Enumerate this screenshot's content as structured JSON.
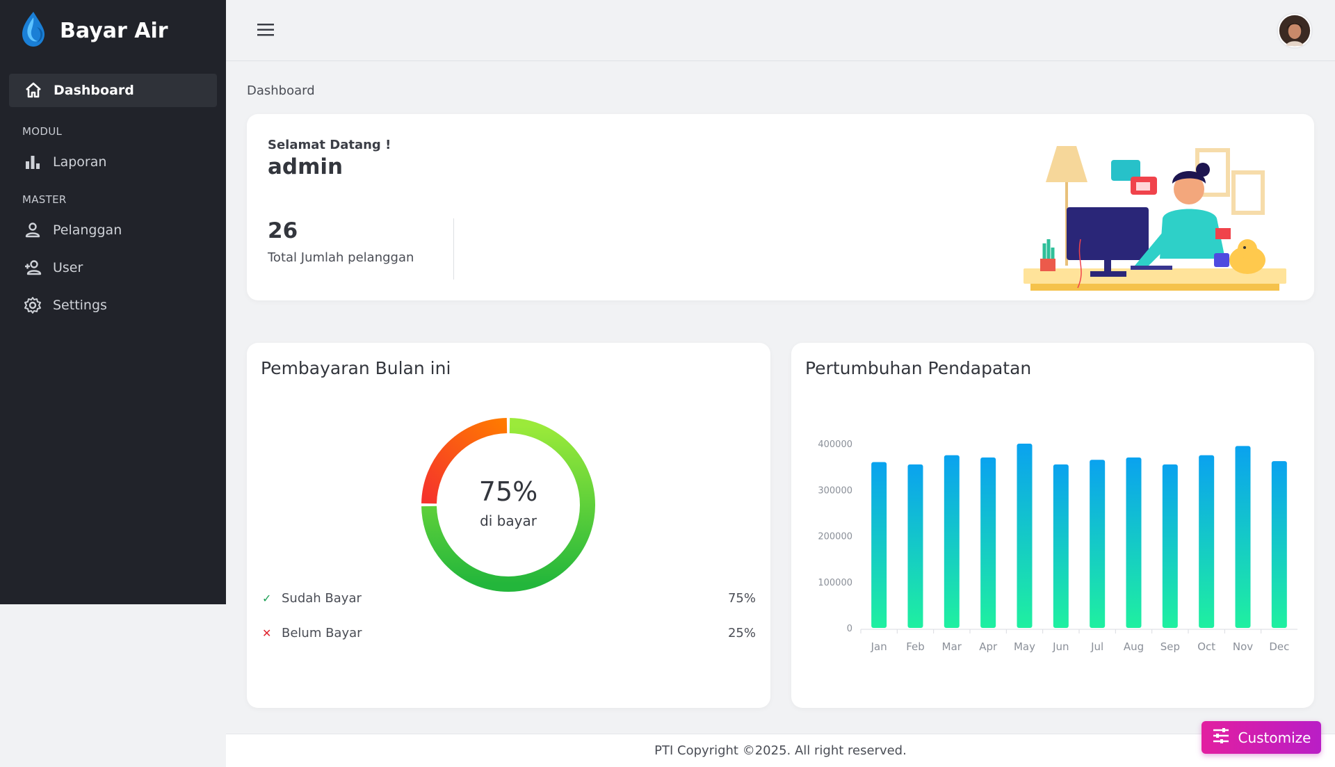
{
  "app": {
    "name": "Bayar Air"
  },
  "sidebar": {
    "active": {
      "label": "Dashboard",
      "icon": "home-icon"
    },
    "sections": [
      {
        "title": "MODUL",
        "items": [
          {
            "label": "Laporan",
            "icon": "bar-chart-icon"
          }
        ]
      },
      {
        "title": "MASTER",
        "items": [
          {
            "label": "Pelanggan",
            "icon": "person-icon"
          },
          {
            "label": "User",
            "icon": "add-user-icon"
          },
          {
            "label": "Settings",
            "icon": "gear-icon"
          }
        ]
      }
    ]
  },
  "breadcrumb": "Dashboard",
  "welcome": {
    "greeting": "Selamat Datang !",
    "username": "admin",
    "total": "26",
    "total_label": "Total Jumlah pelanggan"
  },
  "payment": {
    "title": "Pembayaran Bulan ini",
    "center_value": "75%",
    "center_label": "di bayar",
    "paid_fraction": 0.75,
    "legend": [
      {
        "mark": "✓",
        "label": "Sudah Bayar",
        "value": "75%",
        "color": "#1aa053"
      },
      {
        "mark": "✕",
        "label": "Belum Bayar",
        "value": "25%",
        "color": "#e0232e"
      }
    ],
    "colors": {
      "paid_start": "#9bea3a",
      "paid_end": "#23b63b",
      "unpaid_start": "#ff7a00",
      "unpaid_end": "#f5332c"
    }
  },
  "growth": {
    "title": "Pertumbuhan Pendapatan"
  },
  "chart_data": {
    "type": "bar",
    "title": "Pertumbuhan Pendapatan",
    "categories": [
      "Jan",
      "Feb",
      "Mar",
      "Apr",
      "May",
      "Jun",
      "Jul",
      "Aug",
      "Sep",
      "Oct",
      "Nov",
      "Dec"
    ],
    "values": [
      360000,
      355000,
      375000,
      370000,
      400000,
      355000,
      365000,
      370000,
      355000,
      375000,
      395000,
      362000
    ],
    "ylim": [
      0,
      400000
    ],
    "yticks": [
      "0",
      "100000",
      "200000",
      "300000",
      "400000"
    ],
    "grid": false,
    "colors": {
      "bar_top": "#0aa2ef",
      "bar_bottom": "#1ff0a0"
    }
  },
  "footer": {
    "text": "PTI Copyright ©2025. All right reserved."
  },
  "customize": {
    "label": "Customize"
  }
}
